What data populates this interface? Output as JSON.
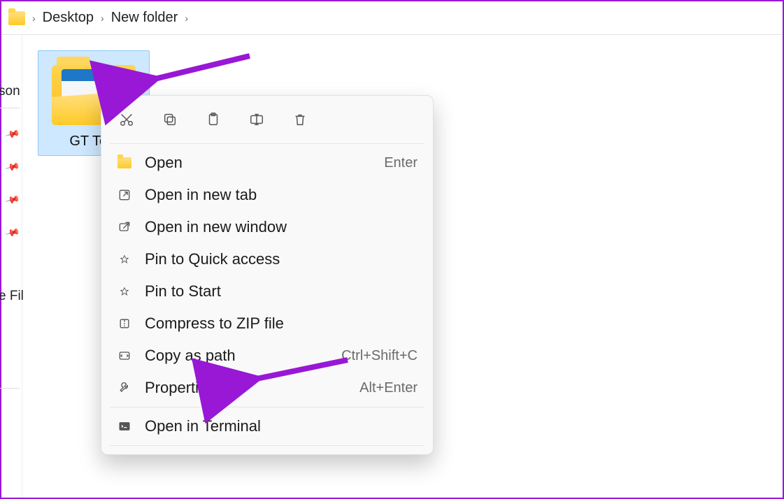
{
  "breadcrumb": {
    "items": [
      "Desktop",
      "New folder"
    ]
  },
  "sidebar": {
    "label_top": "son",
    "label_bottom": "e Fil"
  },
  "selected_folder": {
    "name": "GT Test"
  },
  "context_menu": {
    "action_icons": [
      "cut",
      "copy",
      "paste",
      "rename",
      "delete"
    ],
    "items": [
      {
        "icon": "folder",
        "label": "Open",
        "shortcut": "Enter"
      },
      {
        "icon": "new-tab",
        "label": "Open in new tab",
        "shortcut": ""
      },
      {
        "icon": "new-window",
        "label": "Open in new window",
        "shortcut": ""
      },
      {
        "icon": "pin",
        "label": "Pin to Quick access",
        "shortcut": ""
      },
      {
        "icon": "pin",
        "label": "Pin to Start",
        "shortcut": ""
      },
      {
        "icon": "zip",
        "label": "Compress to ZIP file",
        "shortcut": ""
      },
      {
        "icon": "copy-path",
        "label": "Copy as path",
        "shortcut": "Ctrl+Shift+C"
      },
      {
        "icon": "wrench",
        "label": "Properties",
        "shortcut": "Alt+Enter"
      }
    ],
    "items_after_sep": [
      {
        "icon": "terminal",
        "label": "Open in Terminal",
        "shortcut": ""
      }
    ]
  },
  "annotation": {
    "arrow_color": "#9818d6"
  }
}
